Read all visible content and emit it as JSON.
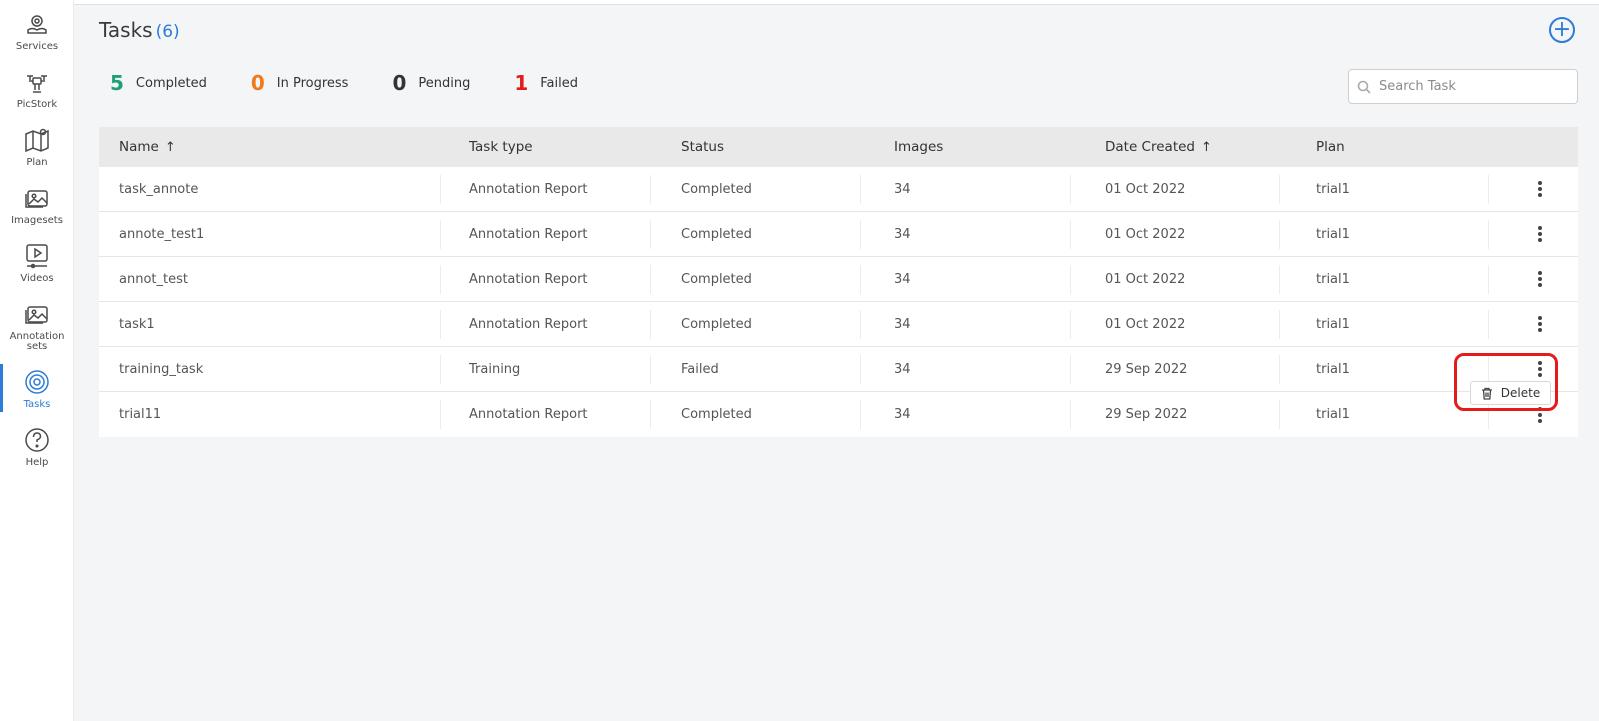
{
  "sidebar": {
    "items": [
      {
        "label": "Services",
        "icon": "services-icon"
      },
      {
        "label": "PicStork",
        "icon": "drone-icon"
      },
      {
        "label": "Plan",
        "icon": "map-icon"
      },
      {
        "label": "Imagesets",
        "icon": "images-icon"
      },
      {
        "label": "Videos",
        "icon": "video-icon"
      },
      {
        "label": "Annotation sets",
        "icon": "annotation-icon"
      },
      {
        "label": "Tasks",
        "icon": "tasks-icon",
        "active": true
      },
      {
        "label": "Help",
        "icon": "help-icon"
      }
    ]
  },
  "header": {
    "title": "Tasks",
    "count": "(6)",
    "add_icon": "plus-circle-icon"
  },
  "stats": [
    {
      "num": "5",
      "label": "Completed",
      "color": "#1f9e77"
    },
    {
      "num": "0",
      "label": "In Progress",
      "color": "#f07a1a"
    },
    {
      "num": "0",
      "label": "Pending",
      "color": "#333333"
    },
    {
      "num": "1",
      "label": "Failed",
      "color": "#e31b1b"
    }
  ],
  "search": {
    "placeholder": "Search Task"
  },
  "table": {
    "columns": [
      "Name",
      "Task type",
      "Status",
      "Images",
      "Date Created",
      "Plan"
    ],
    "sort_arrow": "↑",
    "rows": [
      [
        "task_annote",
        "Annotation Report",
        "Completed",
        "34",
        "01 Oct 2022",
        "trial1"
      ],
      [
        "annote_test1",
        "Annotation Report",
        "Completed",
        "34",
        "01 Oct 2022",
        "trial1"
      ],
      [
        "annot_test",
        "Annotation Report",
        "Completed",
        "34",
        "01 Oct 2022",
        "trial1"
      ],
      [
        "task1",
        "Annotation Report",
        "Completed",
        "34",
        "01 Oct 2022",
        "trial1"
      ],
      [
        "training_task",
        "Training",
        "Failed",
        "34",
        "29 Sep 2022",
        "trial1"
      ],
      [
        "trial11",
        "Annotation Report",
        "Completed",
        "34",
        "29 Sep 2022",
        "trial1"
      ]
    ]
  },
  "row_menu": {
    "delete_label": "Delete",
    "icon": "trash-icon"
  },
  "accent_color": "#2d7cd6",
  "highlight_color": "#e31b1b"
}
